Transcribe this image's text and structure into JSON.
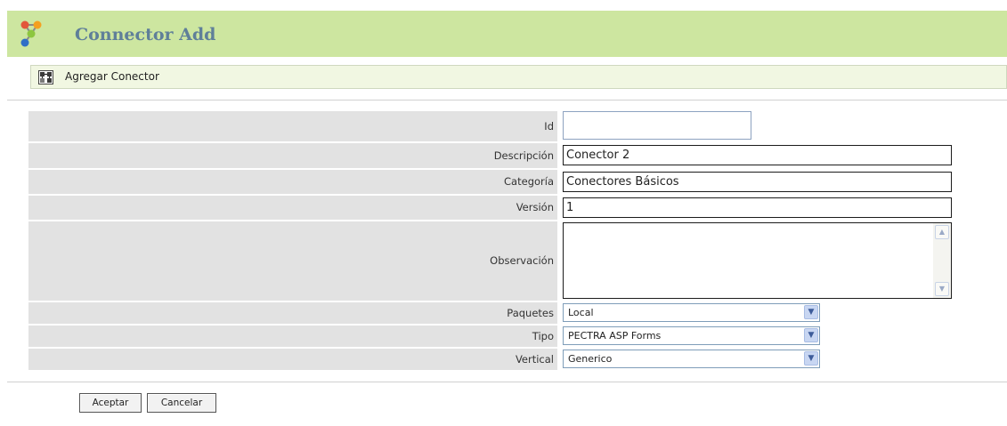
{
  "header": {
    "title": "Connector Add",
    "logo_icon": "app-logo-icon"
  },
  "subheader": {
    "title": "Agregar Conector",
    "icon": "connector-icon"
  },
  "form": {
    "id": {
      "label": "Id",
      "value": ""
    },
    "descripcion": {
      "label": "Descripción",
      "value": "Conector 2"
    },
    "categoria": {
      "label": "Categoría",
      "value": "Conectores Básicos"
    },
    "version": {
      "label": "Versión",
      "value": "1"
    },
    "observacion": {
      "label": "Observación",
      "value": ""
    },
    "paquetes": {
      "label": "Paquetes",
      "selected": "Local"
    },
    "tipo": {
      "label": "Tipo",
      "selected": "PECTRA ASP Forms"
    },
    "vertical": {
      "label": "Vertical",
      "selected": "Generico"
    }
  },
  "buttons": {
    "accept": "Aceptar",
    "cancel": "Cancelar"
  },
  "colors": {
    "title_bar_bg": "#cde6a0",
    "title_text": "#5f7f99",
    "subheader_bg": "#f1f7e2",
    "label_row_bg": "#e2e2e2"
  }
}
